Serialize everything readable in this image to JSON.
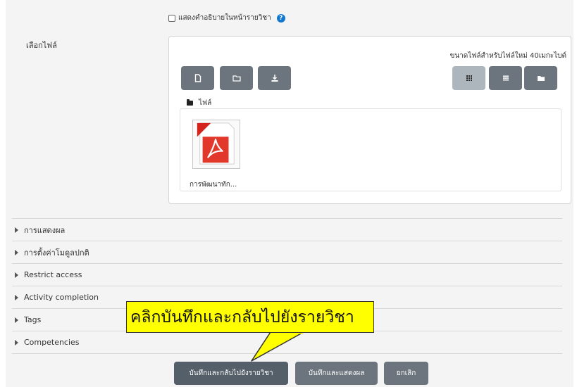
{
  "show_description": {
    "label": "แสดงคำอธิบายในหน้ารายวิชา",
    "checked": false,
    "help_icon": "?"
  },
  "file_picker": {
    "label": "เลือกไฟล์",
    "max_size_text": "ขนาดไฟล์สำหรับไฟล์ใหม่ 40เมกะไบต์",
    "toolbar_icons": [
      "add-file-icon",
      "create-folder-icon",
      "download-icon"
    ],
    "view_icons": [
      "grid-view-icon",
      "list-view-icon",
      "tree-view-icon"
    ],
    "active_view": "grid",
    "path_label": "ไฟล์",
    "files": [
      {
        "name": "การพัฒนาทัก...",
        "icon": "pdf-icon"
      }
    ]
  },
  "sections": [
    {
      "label": "การแสดงผล"
    },
    {
      "label": "การตั้งค่าโมดูลปกติ"
    },
    {
      "label": "Restrict access"
    },
    {
      "label": "Activity completion"
    },
    {
      "label": "Tags"
    },
    {
      "label": "Competencies"
    }
  ],
  "callout": {
    "text": "คลิกบันทึกและกลับไปยังรายวิชา"
  },
  "buttons": {
    "save_return": "บันทึกและกลับไปยังรายวิชา",
    "save_display": "บันทึกและแสดงผล",
    "cancel": "ยกเลิก"
  },
  "colors": {
    "primary_button": "#555f69",
    "secondary_button": "#6c757d",
    "callout_bg": "#ffff00",
    "help_icon": "#1177d1"
  }
}
